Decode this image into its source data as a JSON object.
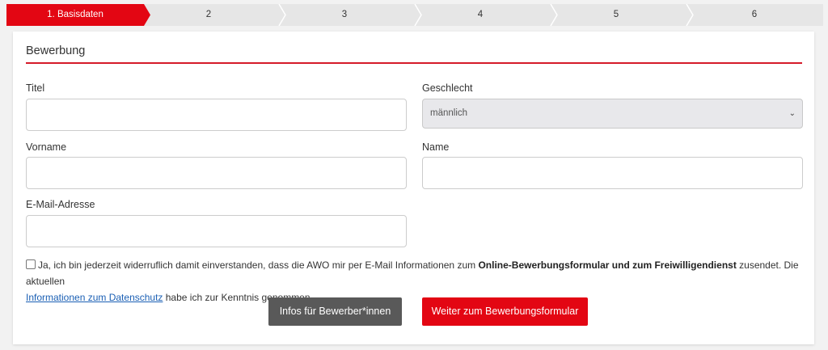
{
  "stepper": {
    "steps": [
      "1. Basisdaten",
      "2",
      "3",
      "4",
      "5",
      "6"
    ],
    "active_color": "#e30613"
  },
  "form": {
    "title": "Bewerbung",
    "fields": {
      "titel_label": "Titel",
      "titel_value": "",
      "geschlecht_label": "Geschlecht",
      "geschlecht_value": "männlich",
      "vorname_label": "Vorname",
      "vorname_value": "",
      "name_label": "Name",
      "name_value": "",
      "email_label": "E-Mail-Adresse",
      "email_value": ""
    },
    "consent": {
      "checked": false,
      "text_before": "Ja, ich bin jederzeit widerruflich damit einverstanden, dass die AWO mir per E-Mail Informationen zum ",
      "bold_text": "Online-Bewerbungsformular und zum Freiwilligendienst",
      "text_middle": " zusendet. Die aktuellen",
      "link_text": "Informationen zum Datenschutz",
      "text_after": " habe ich zur Kenntnis genommen."
    },
    "buttons": {
      "info_label": "Infos für Bewerber*innen",
      "next_label": "Weiter zum Bewerbungsformular"
    }
  }
}
